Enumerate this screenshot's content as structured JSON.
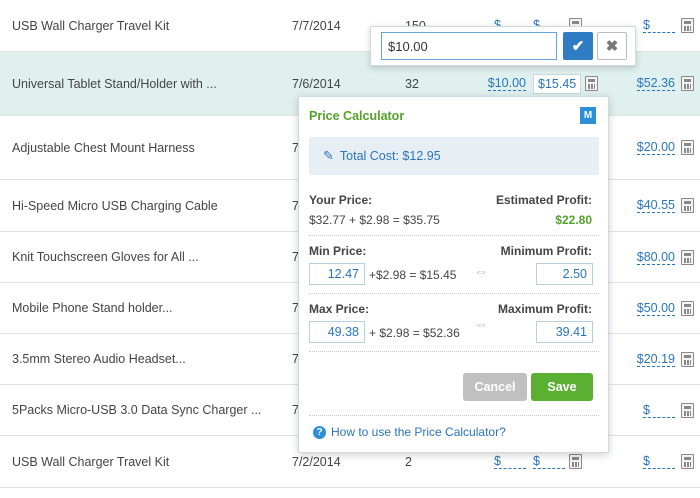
{
  "rows": [
    {
      "name": "USB Wall Charger Travel Kit",
      "date": "7/7/2014",
      "qty": "150",
      "cost": "$",
      "min": "$",
      "max": "$",
      "selected": false
    },
    {
      "name": "Universal Tablet Stand/Holder with ...",
      "date": "7/6/2014",
      "qty": "32",
      "cost": "$10.00",
      "min": "$15.45",
      "max": "$52.36",
      "selected": true
    },
    {
      "name": "Adjustable Chest Mount Harness",
      "date": "7",
      "qty": "",
      "cost": "",
      "min": "",
      "max": "$20.00",
      "selected": false
    },
    {
      "name": "Hi-Speed Micro USB Charging Cable",
      "date": "7",
      "qty": "",
      "cost": "",
      "min": "",
      "max": "$40.55",
      "selected": false
    },
    {
      "name": "Knit Touchscreen Gloves for All ...",
      "date": "7",
      "qty": "",
      "cost": "",
      "min": "",
      "max": "$80.00",
      "selected": false
    },
    {
      "name": "Mobile Phone Stand holder...",
      "date": "7",
      "qty": "",
      "cost": "",
      "min": "",
      "max": "$50.00",
      "selected": false
    },
    {
      "name": "3.5mm Stereo Audio Headset...",
      "date": "7",
      "qty": "",
      "cost": "",
      "min": "",
      "max": "$20.19",
      "selected": false
    },
    {
      "name": "5Packs Micro-USB 3.0 Data Sync Charger ...",
      "date": "7",
      "qty": "",
      "cost": "",
      "min": "",
      "max": "$",
      "selected": false
    },
    {
      "name": "USB Wall Charger Travel Kit",
      "date": "7/2/2014",
      "qty": "2",
      "cost": "$",
      "min": "$",
      "max": "$",
      "selected": false
    }
  ],
  "edit_popup": {
    "value": "$10.00",
    "confirm_icon": "check-icon",
    "cancel_icon": "close-icon"
  },
  "calculator": {
    "title": "Price Calculator",
    "logo": "M",
    "total_cost": "Total Cost: $12.95",
    "your_price_label": "Your Price:",
    "your_price_formula": "$32.77 + $2.98 = $35.75",
    "estimated_profit_label": "Estimated Profit:",
    "estimated_profit_value": "$22.80",
    "min_price_label": "Min Price:",
    "min_price_value": "12.47",
    "min_price_formula": "+$2.98 = $15.45",
    "minimum_profit_label": "Minimum Profit:",
    "minimum_profit_value": "2.50",
    "max_price_label": "Max Price:",
    "max_price_value": "49.38",
    "max_price_formula": "+ $2.98 = $52.36",
    "maximum_profit_label": "Maximum Profit:",
    "maximum_profit_value": "39.41",
    "cancel_label": "Cancel",
    "save_label": "Save",
    "help_text": "How to use the Price Calculator?",
    "accent_green": "#56a12b",
    "accent_blue": "#2a74bd"
  }
}
